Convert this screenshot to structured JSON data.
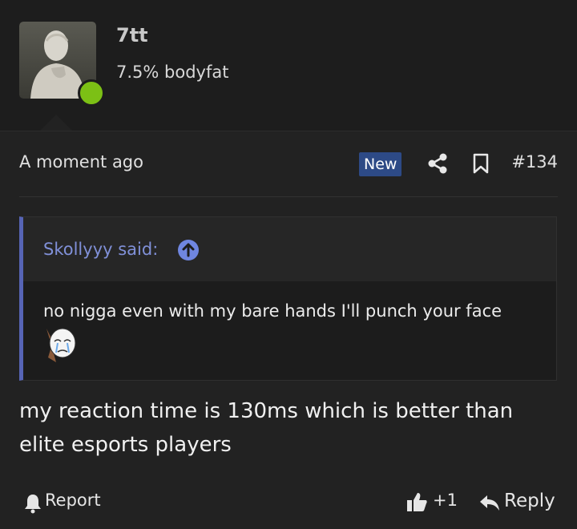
{
  "user": {
    "name": "7tt",
    "title": "7.5% bodyfat"
  },
  "post": {
    "timestamp": "A moment ago",
    "badge": "New",
    "number": "#134",
    "body": "my reaction time is 130ms which is better than elite esports players"
  },
  "quote": {
    "author_line": "Skollyyy said:",
    "text": "no nigga even with my bare hands I'll punch your face"
  },
  "actions": {
    "report_label": "Report",
    "like_count": "+1",
    "reply_label": "Reply"
  },
  "icons": [
    "share-icon",
    "bookmark-icon",
    "arrow-up-icon",
    "bell-icon",
    "thumbs-up-icon",
    "reply-arrow-icon"
  ],
  "colors": {
    "background": "#222222",
    "header": "#1d1d1d",
    "accent": "#2d4a86",
    "quote_border": "#5664b5",
    "online": "#7cc015"
  }
}
